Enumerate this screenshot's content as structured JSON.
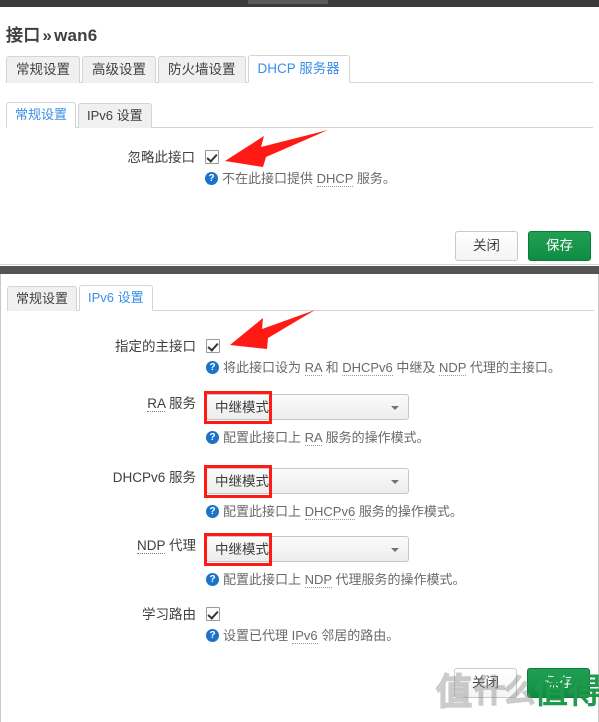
{
  "page": {
    "title_prefix": "接口",
    "title_separator": "»",
    "title_name": "wan6"
  },
  "tabs_primary": [
    {
      "label": "常规设置",
      "active": false
    },
    {
      "label": "高级设置",
      "active": false
    },
    {
      "label": "防火墙设置",
      "active": false
    },
    {
      "label": "DHCP 服务器",
      "active": true
    }
  ],
  "tabs_secondary_upper": [
    {
      "label": "常规设置",
      "active": true
    },
    {
      "label": "IPv6 设置",
      "active": false
    }
  ],
  "tabs_secondary_lower": [
    {
      "label": "常规设置",
      "active": false
    },
    {
      "label": "IPv6 设置",
      "active": true
    }
  ],
  "panel_upper": {
    "rows": [
      {
        "label": "忽略此接口",
        "type": "checkbox",
        "checked": true,
        "help": "不在此接口提供 DHCP 服务。",
        "help_abbr": "DHCP"
      }
    ],
    "buttons": {
      "close": "关闭",
      "save": "保存"
    }
  },
  "panel_lower": {
    "rows": [
      {
        "label": "指定的主接口",
        "label_abbr": "",
        "type": "checkbox",
        "checked": true,
        "help": "将此接口设为 RA 和 DHCPv6 中继及 NDP 代理的主接口。"
      },
      {
        "label": "RA 服务",
        "label_abbr": "RA",
        "type": "select",
        "value": "中继模式",
        "highlighted": true,
        "help": "配置此接口上 RA 服务的操作模式。",
        "help_abbr": "RA"
      },
      {
        "label": "DHCPv6 服务",
        "label_abbr": "",
        "type": "select",
        "value": "中继模式",
        "highlighted": true,
        "help": "配置此接口上 DHCPv6 服务的操作模式。",
        "help_abbr": ""
      },
      {
        "label": "NDP 代理",
        "label_abbr": "NDP",
        "type": "select",
        "value": "中继模式",
        "highlighted": true,
        "help": "配置此接口上 NDP 代理服务的操作模式。",
        "help_abbr": ""
      },
      {
        "label": "学习路由",
        "label_abbr": "",
        "type": "checkbox",
        "checked": true,
        "help": "设置已代理 IPv6 邻居的路由。"
      }
    ],
    "buttons": {
      "close": "关闭",
      "save": "保存"
    }
  },
  "annotations": {
    "arrow_color": "#ff1a15",
    "highlight_box_color": "#ff1a15",
    "arrows": [
      {
        "name": "arrow-to-ignore-interface-checkbox"
      },
      {
        "name": "arrow-to-master-interface-checkbox"
      }
    ]
  },
  "watermark": {
    "char_1": "值",
    "char_2": "什",
    "char_3": "么",
    "badge_text": "值得买"
  },
  "colors": {
    "accent_link": "#3a8ee6",
    "save_green": "#0f8c42",
    "help_icon_blue": "#1a73c8",
    "annotation_red": "#ff1a15",
    "text": "#404040"
  }
}
